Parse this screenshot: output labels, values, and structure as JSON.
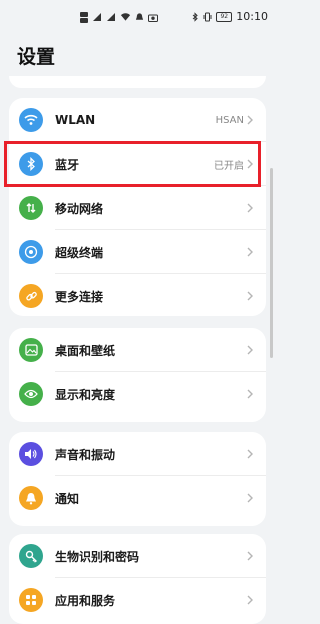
{
  "status_bar": {
    "time": "10:10",
    "battery": "92"
  },
  "page_title": "设置",
  "colors": {
    "wlan": "#3d9be9",
    "bluetooth": "#3d9be9",
    "mobile": "#45b04a",
    "super": "#3d9be9",
    "more": "#f5a623",
    "desktop": "#45b04a",
    "display": "#45b04a",
    "sound": "#5b4fe0",
    "notify": "#f5a623",
    "bio": "#2fa58e",
    "apps": "#f5a623",
    "highlight": "#e8202a"
  },
  "groups": [
    {
      "items": [
        {
          "label": "WLAN",
          "value": "HSAN",
          "icon": "wifi-icon"
        },
        {
          "label": "蓝牙",
          "value": "已开启",
          "icon": "bluetooth-icon"
        },
        {
          "label": "移动网络",
          "value": "",
          "icon": "mobile-data-icon"
        },
        {
          "label": "超级终端",
          "value": "",
          "icon": "super-device-icon"
        },
        {
          "label": "更多连接",
          "value": "",
          "icon": "link-icon"
        }
      ]
    },
    {
      "items": [
        {
          "label": "桌面和壁纸",
          "value": "",
          "icon": "wallpaper-icon"
        },
        {
          "label": "显示和亮度",
          "value": "",
          "icon": "eye-icon"
        }
      ]
    },
    {
      "items": [
        {
          "label": "声音和振动",
          "value": "",
          "icon": "speaker-icon"
        },
        {
          "label": "通知",
          "value": "",
          "icon": "bell-icon"
        }
      ]
    },
    {
      "items": [
        {
          "label": "生物识别和密码",
          "value": "",
          "icon": "key-icon"
        },
        {
          "label": "应用和服务",
          "value": "",
          "icon": "apps-icon"
        }
      ]
    }
  ]
}
